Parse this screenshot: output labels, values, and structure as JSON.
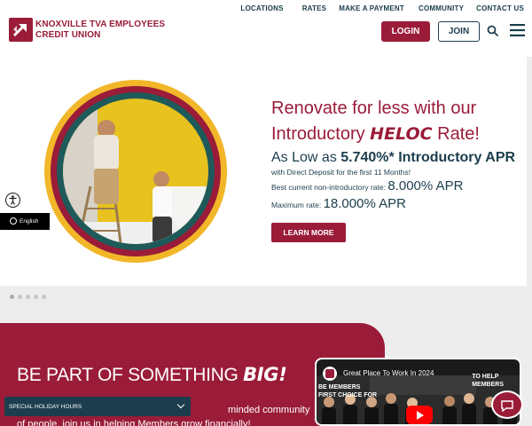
{
  "header": {
    "top_links": [
      "LOCATIONS",
      "RATES",
      "MAKE A PAYMENT",
      "COMMUNITY",
      "CONTACT US"
    ],
    "logo": {
      "line1": "KNOXVILLE TVA EMPLOYEES",
      "line2": "CREDIT UNION"
    },
    "login_label": "LOGIN",
    "join_label": "JOIN",
    "icons": {
      "search": "search-icon",
      "menu": "menu-icon"
    }
  },
  "hero": {
    "title_line1": "Renovate for less with our",
    "title_pre": "Introductory ",
    "title_heloc": "HELOC",
    "title_post": " Rate!",
    "rate_pre": "As Low as ",
    "rate_value": "5.740%* Introductory APR",
    "rate_note": "with Direct Deposit for the first 11 Months!",
    "current_label": "Best current non-introductory rate: ",
    "current_value": "8.000% APR",
    "max_label": "Maximum rate: ",
    "max_value": "18.000% APR",
    "cta_label": "LEARN MORE",
    "slides": 5,
    "active_slide": 1
  },
  "widgets": {
    "language_label": "English",
    "holiday_label": "SPECIAL HOLIDAY HOURS"
  },
  "section": {
    "title_pre": "BE PART OF SOMETHING ",
    "title_big": "BIG!",
    "body_line1": "minded community",
    "body_line2": "of people, join us in helping Members grow financially!"
  },
  "video": {
    "title": "Great Place To Work In 2024",
    "overlay_left": "BE MEMBERS\nFIRST CHOICE FOR",
    "overlay_right": "TO HELP\nMEMBERS"
  },
  "colors": {
    "brand": "#9a1c39",
    "navy": "#1c3d4d",
    "ring_yellow": "#f2b729",
    "ring_teal": "#1e5a5a"
  }
}
